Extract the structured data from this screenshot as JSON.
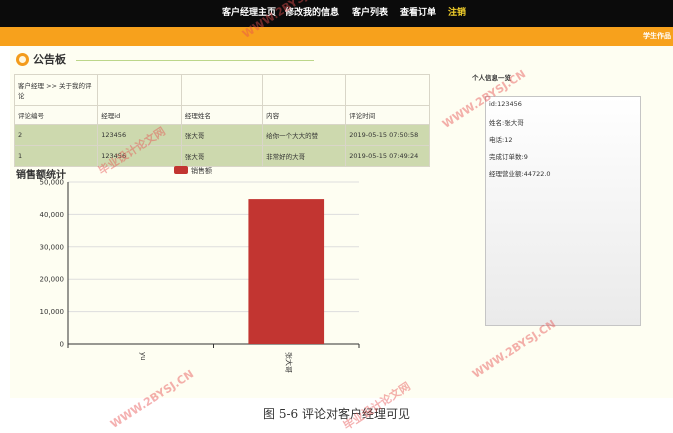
{
  "nav": {
    "items": [
      {
        "label": "客户经理主页"
      },
      {
        "label": "修改我的信息"
      },
      {
        "label": "客户列表"
      },
      {
        "label": "查看订单"
      },
      {
        "label": "注销"
      }
    ]
  },
  "orange_bar": {
    "right_text": "学生作品"
  },
  "board": {
    "title": "公告板",
    "breadcrumb": "客户经理 >> 关于我的评论",
    "columns": [
      "评论编号",
      "经理id",
      "经理姓名",
      "内容",
      "评论时间"
    ],
    "rows": [
      [
        "2",
        "123456",
        "张大哥",
        "给你一个大大的赞",
        "2019-05-15 07:50:58"
      ],
      [
        "1",
        "123456",
        "张大哥",
        "非常好的大哥",
        "2019-05-15 07:49:24"
      ]
    ]
  },
  "chart_title": "销售额统计",
  "chart_data": {
    "type": "bar",
    "categories": [
      "yu",
      "张大哥"
    ],
    "series": [
      {
        "name": "销售额",
        "values": [
          0,
          44722
        ]
      }
    ],
    "ylim": [
      0,
      50000
    ],
    "yticks": [
      "0",
      "10,000",
      "20,000",
      "30,000",
      "40,000",
      "50,000"
    ],
    "grid": true,
    "legend": "top",
    "colors": {
      "bar": "#c23531"
    }
  },
  "personal_info": {
    "label": "个人信息一览",
    "lines": [
      "id:123456",
      "姓名:张大哥",
      "电话:12",
      "完成订单数:9",
      "经理营业额:44722.0"
    ]
  },
  "caption": "图 5-6 评论对客户经理可见",
  "watermarks": [
    "WWW.2BYSJ.CN",
    "毕业设计论文网"
  ]
}
